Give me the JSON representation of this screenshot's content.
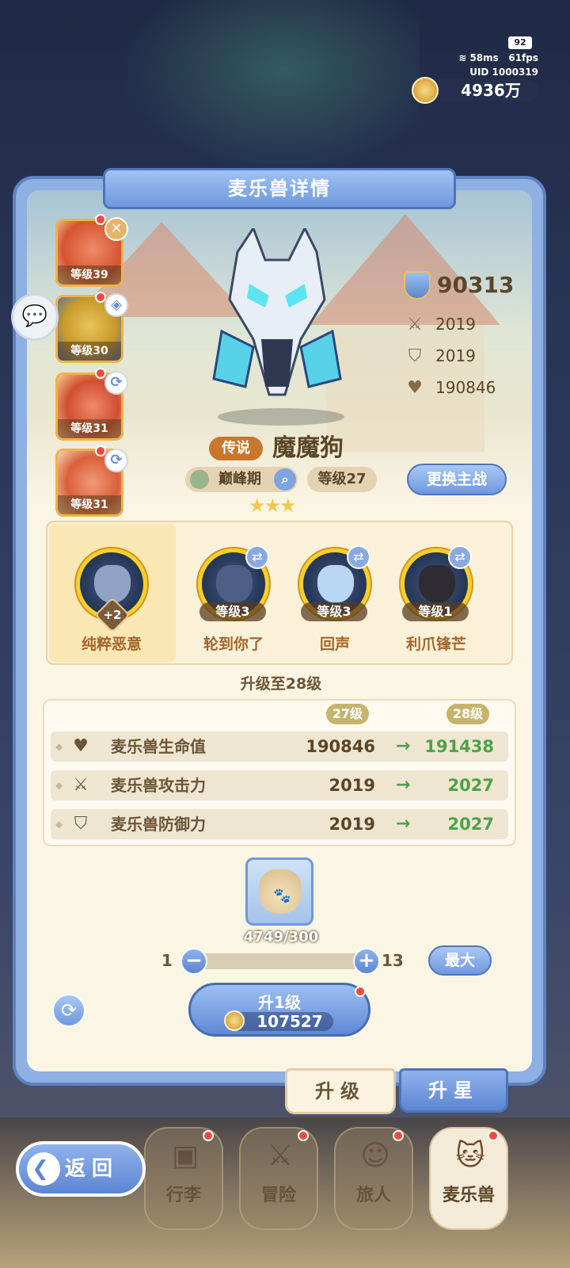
{
  "status": {
    "battery": "92",
    "ping": "58ms",
    "fps": "61fps",
    "uid": "UID 1000319",
    "gold": "4936万"
  },
  "panel": {
    "title": "麦乐兽详情"
  },
  "side_cards": [
    {
      "level": "等级39",
      "badge": "✕"
    },
    {
      "level": "等级30",
      "badge": "◈"
    },
    {
      "level": "等级31",
      "badge": "⟳"
    },
    {
      "level": "等级31",
      "badge": "⟳"
    }
  ],
  "beast": {
    "power": "90313",
    "attack": "2019",
    "defense": "2019",
    "hp": "190846",
    "rarity": "传说",
    "name": "魔魔狗",
    "phase": "巅峰期",
    "level": "等级27",
    "stars": "★★★",
    "swap_label": "更换主战"
  },
  "skills": [
    {
      "name": "纯粹恶意",
      "extra": "+2"
    },
    {
      "name": "轮到你了",
      "level": "等级3"
    },
    {
      "name": "回声",
      "level": "等级3"
    },
    {
      "name": "利爪锋芒",
      "level": "等级1"
    }
  ],
  "upgrade": {
    "title": "升级至28级",
    "from_tag": "27级",
    "to_tag": "28级",
    "rows": [
      {
        "icon": "heart-icon",
        "label": "麦乐兽生命值",
        "current": "190846",
        "next": "191438"
      },
      {
        "icon": "swords-icon",
        "label": "麦乐兽攻击力",
        "current": "2019",
        "next": "2027"
      },
      {
        "icon": "shield-icon",
        "label": "麦乐兽防御力",
        "current": "2019",
        "next": "2027"
      }
    ],
    "item_count": "4749/300",
    "slider_min": "1",
    "slider_max": "13",
    "max_label": "最大",
    "levelup_label": "升1级",
    "levelup_cost": "107527"
  },
  "tabs": {
    "upgrade": "升级",
    "star": "升星"
  },
  "nav": {
    "back": "返回",
    "items": [
      "行李",
      "冒险",
      "旅人",
      "麦乐兽"
    ]
  },
  "colors": {
    "accent_blue": "#6f98df",
    "panel_cream": "#fbf5e4",
    "gain_green": "#4ca348",
    "rarity_orange": "#c9762e"
  }
}
